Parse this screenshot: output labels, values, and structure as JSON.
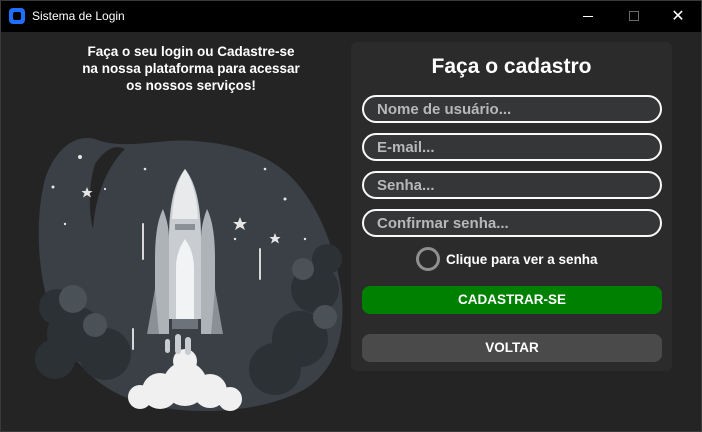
{
  "window": {
    "title": "Sistema de Login",
    "controls": {
      "minimize": "",
      "maximize": "",
      "close": "✕"
    }
  },
  "intro": {
    "lines": [
      "Faça o seu login ou Cadastre-se",
      "na nossa plataforma para acessar",
      "os nossos serviços!"
    ]
  },
  "illustration": {
    "icon": "rocket-launch-illustration"
  },
  "form": {
    "title": "Faça o cadastro",
    "fields": {
      "username": {
        "placeholder": "Nome de usuário...",
        "value": ""
      },
      "email": {
        "placeholder": "E-mail...",
        "value": ""
      },
      "password": {
        "placeholder": "Senha...",
        "value": ""
      },
      "confirm": {
        "placeholder": "Confirmar senha...",
        "value": ""
      }
    },
    "show_password": {
      "label": "Clique para ver a senha",
      "checked": false
    },
    "submit_label": "CADASTRAR-SE",
    "back_label": "VOLTAR"
  },
  "colors": {
    "background": "#242424",
    "card": "#2b2b2b",
    "primary_button": "#008000",
    "secondary_button": "#4a4a4a",
    "field_border": "#fafafa",
    "brand_icon": "#1f6fff"
  }
}
